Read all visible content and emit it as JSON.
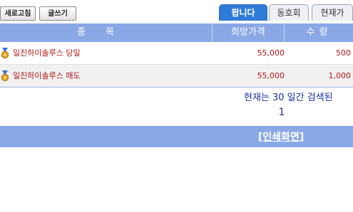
{
  "toolbar": {
    "refresh_label": "새로고침",
    "write_label": "글쓰기"
  },
  "tabs": [
    {
      "label": "팝니다",
      "active": true
    },
    {
      "label": "동호회",
      "active": false
    },
    {
      "label": "현재가",
      "active": false
    }
  ],
  "table": {
    "headers": {
      "name": "종목",
      "price": "희망가격",
      "quantity": "수량"
    },
    "rows": [
      {
        "name": "일진하이솔루스 당일",
        "price": "55,000",
        "quantity": "500"
      },
      {
        "name": "일진하이솔루스 매도",
        "price": "55,000",
        "quantity": "1,000"
      }
    ]
  },
  "info_text": "현재는 30 일간 검색된",
  "pagination": {
    "current": "1"
  },
  "footer": {
    "print_label": "[인쇄화면]"
  },
  "colors": {
    "header_bg": "#8aa8e6",
    "tab_active": "#2e7bd8",
    "row_text": "#b01515",
    "info_text": "#1a2fa8"
  },
  "icons": {
    "row_icon": "medal-icon"
  }
}
